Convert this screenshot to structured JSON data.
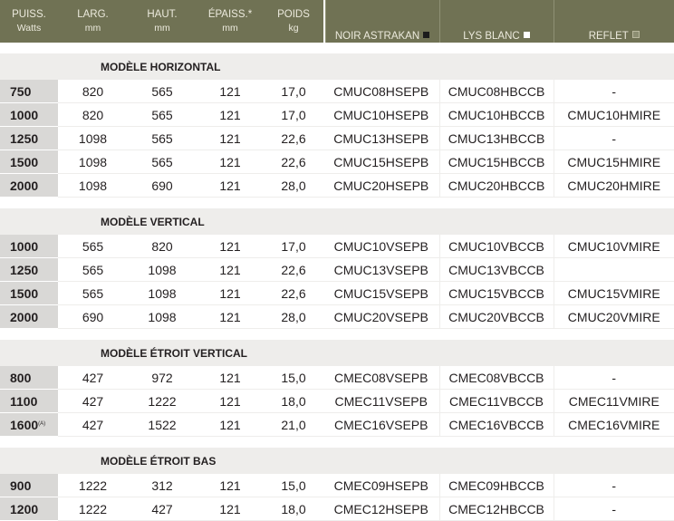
{
  "header": {
    "puiss": "PUISS.",
    "puiss_unit": "Watts",
    "larg": "LARG.",
    "larg_unit": "mm",
    "haut": "HAUT.",
    "haut_unit": "mm",
    "epaiss": "ÉPAISS.*",
    "epaiss_unit": "mm",
    "poids": "POIDS",
    "poids_unit": "kg",
    "noir": "NOIR ASTRAKAN",
    "lys": "LYS BLANC",
    "reflet": "REFLET"
  },
  "sections": [
    {
      "title": "MODÈLE HORIZONTAL",
      "rows": [
        {
          "puiss": "750",
          "larg": "820",
          "haut": "565",
          "epaiss": "121",
          "poids": "17,0",
          "noir": "CMUC08HSEPB",
          "lys": "CMUC08HBCCB",
          "reflet": "-"
        },
        {
          "puiss": "1000",
          "larg": "820",
          "haut": "565",
          "epaiss": "121",
          "poids": "17,0",
          "noir": "CMUC10HSEPB",
          "lys": "CMUC10HBCCB",
          "reflet": "CMUC10HMIRE"
        },
        {
          "puiss": "1250",
          "larg": "1098",
          "haut": "565",
          "epaiss": "121",
          "poids": "22,6",
          "noir": "CMUC13HSEPB",
          "lys": "CMUC13HBCCB",
          "reflet": "-"
        },
        {
          "puiss": "1500",
          "larg": "1098",
          "haut": "565",
          "epaiss": "121",
          "poids": "22,6",
          "noir": "CMUC15HSEPB",
          "lys": "CMUC15HBCCB",
          "reflet": "CMUC15HMIRE"
        },
        {
          "puiss": "2000",
          "larg": "1098",
          "haut": "690",
          "epaiss": "121",
          "poids": "28,0",
          "noir": "CMUC20HSEPB",
          "lys": "CMUC20HBCCB",
          "reflet": "CMUC20HMIRE"
        }
      ]
    },
    {
      "title": "MODÈLE VERTICAL",
      "rows": [
        {
          "puiss": "1000",
          "larg": "565",
          "haut": "820",
          "epaiss": "121",
          "poids": "17,0",
          "noir": "CMUC10VSEPB",
          "lys": "CMUC10VBCCB",
          "reflet": "CMUC10VMIRE"
        },
        {
          "puiss": "1250",
          "larg": "565",
          "haut": "1098",
          "epaiss": "121",
          "poids": "22,6",
          "noir": "CMUC13VSEPB",
          "lys": "CMUC13VBCCB",
          "reflet": ""
        },
        {
          "puiss": "1500",
          "larg": "565",
          "haut": "1098",
          "epaiss": "121",
          "poids": "22,6",
          "noir": "CMUC15VSEPB",
          "lys": "CMUC15VBCCB",
          "reflet": "CMUC15VMIRE"
        },
        {
          "puiss": "2000",
          "larg": "690",
          "haut": "1098",
          "epaiss": "121",
          "poids": "28,0",
          "noir": "CMUC20VSEPB",
          "lys": "CMUC20VBCCB",
          "reflet": "CMUC20VMIRE"
        }
      ]
    },
    {
      "title": "MODÈLE ÉTROIT VERTICAL",
      "rows": [
        {
          "puiss": "800",
          "larg": "427",
          "haut": "972",
          "epaiss": "121",
          "poids": "15,0",
          "noir": "CMEC08VSEPB",
          "lys": "CMEC08VBCCB",
          "reflet": "-"
        },
        {
          "puiss": "1100",
          "larg": "427",
          "haut": "1222",
          "epaiss": "121",
          "poids": "18,0",
          "noir": "CMEC11VSEPB",
          "lys": "CMEC11VBCCB",
          "reflet": "CMEC11VMIRE"
        },
        {
          "puiss": "1600",
          "puiss_note": "(A)",
          "larg": "427",
          "haut": "1522",
          "epaiss": "121",
          "poids": "21,0",
          "noir": "CMEC16VSEPB",
          "lys": "CMEC16VBCCB",
          "reflet": "CMEC16VMIRE"
        }
      ]
    },
    {
      "title": "MODÈLE ÉTROIT BAS",
      "rows": [
        {
          "puiss": "900",
          "larg": "1222",
          "haut": "312",
          "epaiss": "121",
          "poids": "15,0",
          "noir": "CMEC09HSEPB",
          "lys": "CMEC09HBCCB",
          "reflet": "-"
        },
        {
          "puiss": "1200",
          "larg": "1222",
          "haut": "427",
          "epaiss": "121",
          "poids": "18,0",
          "noir": "CMEC12HSEPB",
          "lys": "CMEC12HBCCB",
          "reflet": "-"
        }
      ]
    }
  ],
  "colors": {
    "header_bg": "#707254",
    "header_text": "#eceadd",
    "section_bg": "#eeedeb",
    "puiss_cell_bg": "#d9d8d6"
  }
}
